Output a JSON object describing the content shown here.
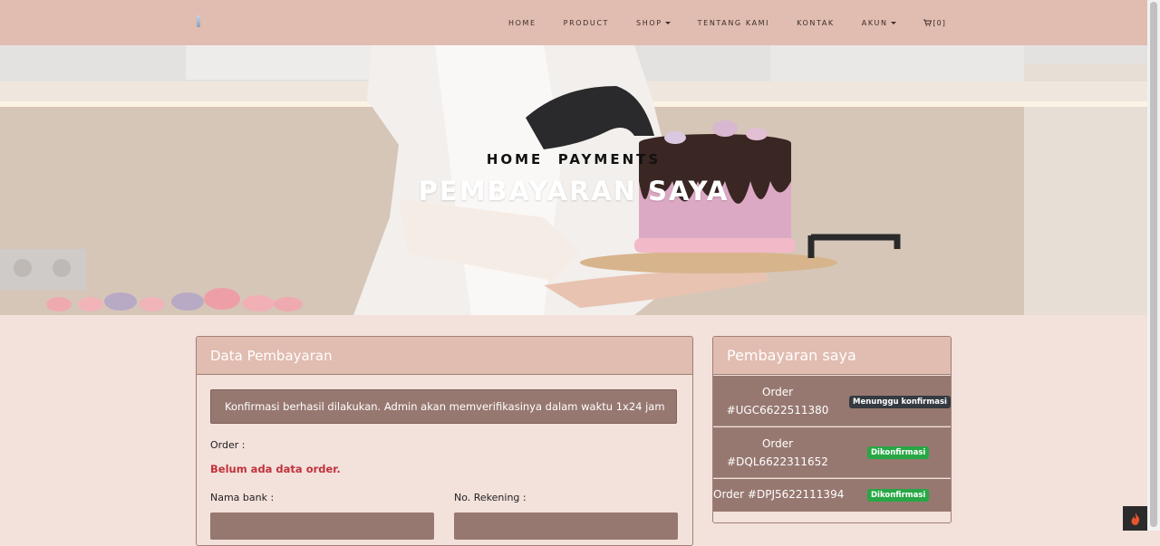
{
  "nav": {
    "items": [
      {
        "label": "HOME",
        "dropdown": false
      },
      {
        "label": "PRODUCT",
        "dropdown": false
      },
      {
        "label": "SHOP",
        "dropdown": true
      },
      {
        "label": "TENTANG KAMI",
        "dropdown": false
      },
      {
        "label": "KONTAK",
        "dropdown": false
      },
      {
        "label": "AKUN",
        "dropdown": true
      }
    ],
    "cart_label": "[0]"
  },
  "hero": {
    "breadcrumb": "HOME  PAYMENTS",
    "title": "PEMBAYARAN SAYA"
  },
  "payment_form": {
    "title": "Data Pembayaran",
    "alert": "Konfirmasi berhasil dilakukan. Admin akan memverifikasinya dalam waktu 1x24 jam",
    "order_label": "Order :",
    "empty_order": "Belum ada data order.",
    "bank_label": "Nama bank :",
    "account_label": "No. Rekening :"
  },
  "my_payments": {
    "title": "Pembayaran saya",
    "orders": [
      {
        "line1": "Order",
        "line2": "#UGC6622511380",
        "status": "Menunggu konfirmasi",
        "status_type": "pending"
      },
      {
        "line1": "Order",
        "line2": "#DQL6622311652",
        "status": "Dikonfirmasi",
        "status_type": "confirmed"
      },
      {
        "line1": "Order #DPJ5622111394",
        "line2": "",
        "status": "Dikonfirmasi",
        "status_type": "confirmed"
      }
    ]
  },
  "colors": {
    "navbar": "#e1bcb0",
    "page_bg": "#f3e1db",
    "muted_brown": "#977870",
    "pending_badge": "#343a40",
    "confirmed_badge": "#28a745",
    "error_text": "#c0323c"
  }
}
